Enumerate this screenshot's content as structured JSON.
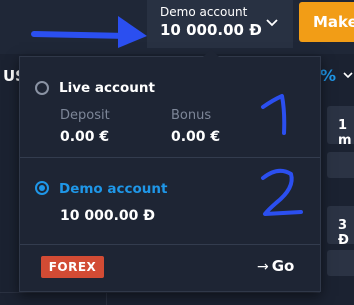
{
  "header": {
    "account_name": "Demo account",
    "account_balance": "10 000.00 Đ",
    "make_button": "Make"
  },
  "background": {
    "left_label": "US",
    "percent_symbol": "%",
    "right_values": [
      "1 m",
      "3 Đ"
    ]
  },
  "dropdown": {
    "live": {
      "label": "Live account",
      "selected": false,
      "deposit_label": "Deposit",
      "deposit_value": "0.00 €",
      "bonus_label": "Bonus",
      "bonus_value": "0.00 €"
    },
    "demo": {
      "label": "Demo account",
      "selected": true,
      "balance": "10 000.00 Đ"
    },
    "footer": {
      "badge": "FOREX",
      "go_label": "Go"
    }
  },
  "colors": {
    "accent_blue": "#1f97e8",
    "make_orange": "#f29d16",
    "forex_red": "#d24b34",
    "annotation_blue": "#2b4ff0"
  },
  "icons": [
    "chevron-down-icon",
    "arrow-right-icon",
    "radio-icon"
  ]
}
